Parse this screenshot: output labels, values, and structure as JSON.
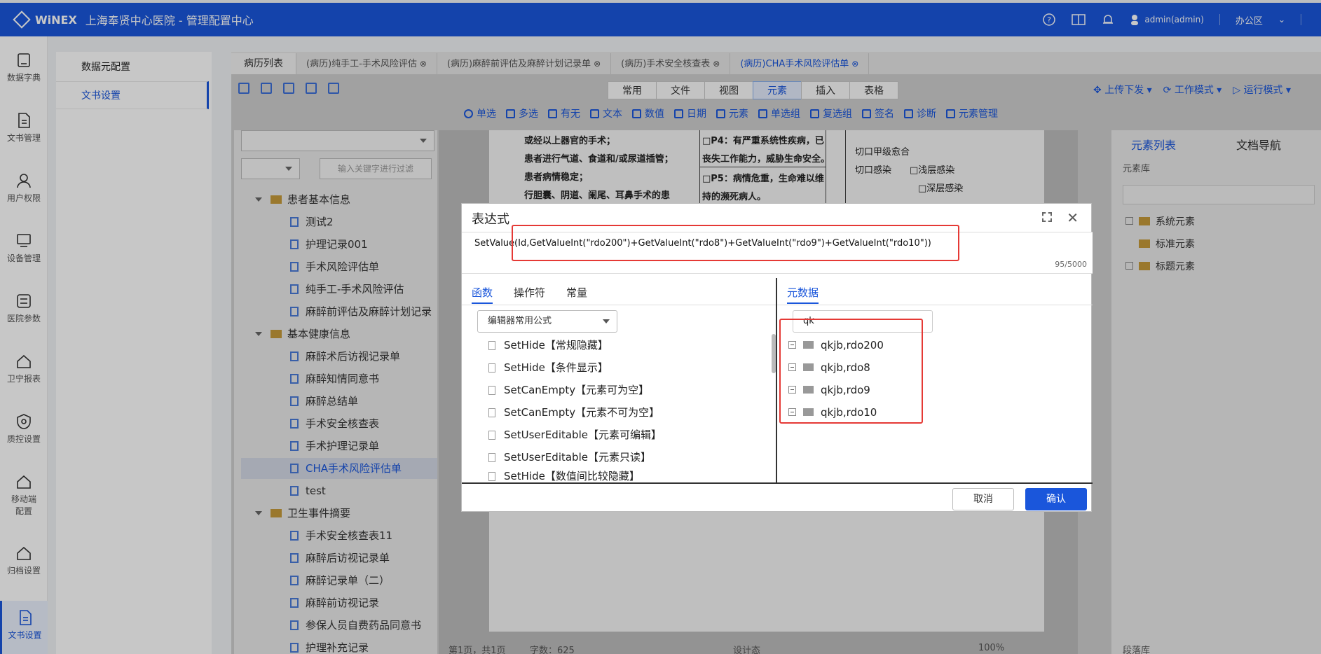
{
  "header": {
    "brand": "WiNEX",
    "title": "上海奉贤中心医院 - 管理配置中心",
    "user": "admin(admin)",
    "office": "办公区"
  },
  "leftnav": [
    {
      "label": "数据字典",
      "icon": "book-icon"
    },
    {
      "label": "文书管理",
      "icon": "document-icon"
    },
    {
      "label": "用户权限",
      "icon": "user-icon"
    },
    {
      "label": "设备管理",
      "icon": "monitor-icon"
    },
    {
      "label": "医院参数",
      "icon": "sliders-icon"
    },
    {
      "label": "卫宁报表",
      "icon": "home-icon"
    },
    {
      "label": "质控设置",
      "icon": "shield-icon"
    },
    {
      "label": "移动端配置",
      "icon": "home-icon"
    },
    {
      "label": "归档设置",
      "icon": "home-icon"
    },
    {
      "label": "文书设置",
      "icon": "document-icon",
      "active": true
    }
  ],
  "subnav": [
    {
      "label": "数据元配置"
    },
    {
      "label": "文书设置",
      "active": true
    }
  ],
  "tabs": [
    {
      "label": "病历列表"
    },
    {
      "label": "(病历)纯手工-手术风险评估"
    },
    {
      "label": "(病历)麻醉前评估及麻醉计划记录单"
    },
    {
      "label": "(病历)手术安全核查表"
    },
    {
      "label": "(病历)CHA手术风险评估单"
    }
  ],
  "ribbon": [
    "常用",
    "文件",
    "视图",
    "元素",
    "插入",
    "表格"
  ],
  "ribbon_active": "元素",
  "modes": [
    "上传下发",
    "工作模式",
    "运行模式"
  ],
  "element_toolbar": [
    "单选",
    "多选",
    "有无",
    "文本",
    "数值",
    "日期",
    "元素",
    "单选组",
    "复选组",
    "签名",
    "诊断",
    "元素管理"
  ],
  "tree": {
    "filter_placeholder": "输入关键字进行过滤",
    "groups": [
      {
        "name": "患者基本信息",
        "items": [
          "测试2",
          "护理记录001",
          "手术风险评估单",
          "纯手工-手术风险评估",
          "麻醉前评估及麻醉计划记录"
        ]
      },
      {
        "name": "基本健康信息",
        "items": [
          "麻醉术后访视记录单",
          "麻醉知情同意书",
          "麻醉总结单",
          "手术安全核查表",
          "手术护理记录单",
          "CHA手术风险评估单",
          "test"
        ]
      },
      {
        "name": "卫生事件摘要",
        "items": [
          "手术安全核查表11",
          "麻醉后访视记录单",
          "麻醉记录单（二）",
          "麻醉前访视记录",
          "参保人员自费药品同意书",
          "护理补充记录"
        ]
      }
    ]
  },
  "document_text": [
    "或经以上器官的手术；",
    "患者进行气道、食道和/或尿道插管；",
    "患者病情稳定；",
    "行胆囊、阴道、阑尾、耳鼻手术的患",
    "□P4：有严重系统性疾病，已",
    "丧失工作能力，威胁生命安全。",
    "□P5：病情危重，生命难以维",
    "持的濒死病人。",
    "切口甲级愈合",
    "切口感染",
    "□浅层感染",
    "□深层感染"
  ],
  "statusbar": [
    "第1页，共1页",
    "字数：625",
    "设计态",
    "100%"
  ],
  "element_panel": {
    "tabs": [
      "元素列表",
      "文档导航"
    ],
    "lib_label": "元素库",
    "items": [
      "系统元素",
      "标准元素",
      "标题元素"
    ],
    "bottom_label": "段落库"
  },
  "dialog": {
    "title": "表达式",
    "expression": "SetValue(Id,GetValueInt(\"rdo200\")+GetValueInt(\"rdo8\")+GetValueInt(\"rdo9\")+GetValueInt(\"rdo10\"))",
    "char_count": "95/5000",
    "left_tabs": [
      "函数",
      "操作符",
      "常量"
    ],
    "formula_select": "编辑器常用公式",
    "functions": [
      "SetHide【常规隐藏】",
      "SetHide【条件显示】",
      "SetCanEmpty【元素可为空】",
      "SetCanEmpty【元素不可为空】",
      "SetUserEditable【元素可编辑】",
      "SetUserEditable【元素只读】",
      "SetHide【数值间比较隐藏】"
    ],
    "right_tab": "元数据",
    "search_value": "qk",
    "metadata": [
      "qkjb,rdo200",
      "qkjb,rdo8",
      "qkjb,rdo9",
      "qkjb,rdo10"
    ],
    "cancel_label": "取消",
    "ok_label": "确认"
  },
  "colors": {
    "primary": "#1a56db",
    "highlight": "#e53935"
  }
}
